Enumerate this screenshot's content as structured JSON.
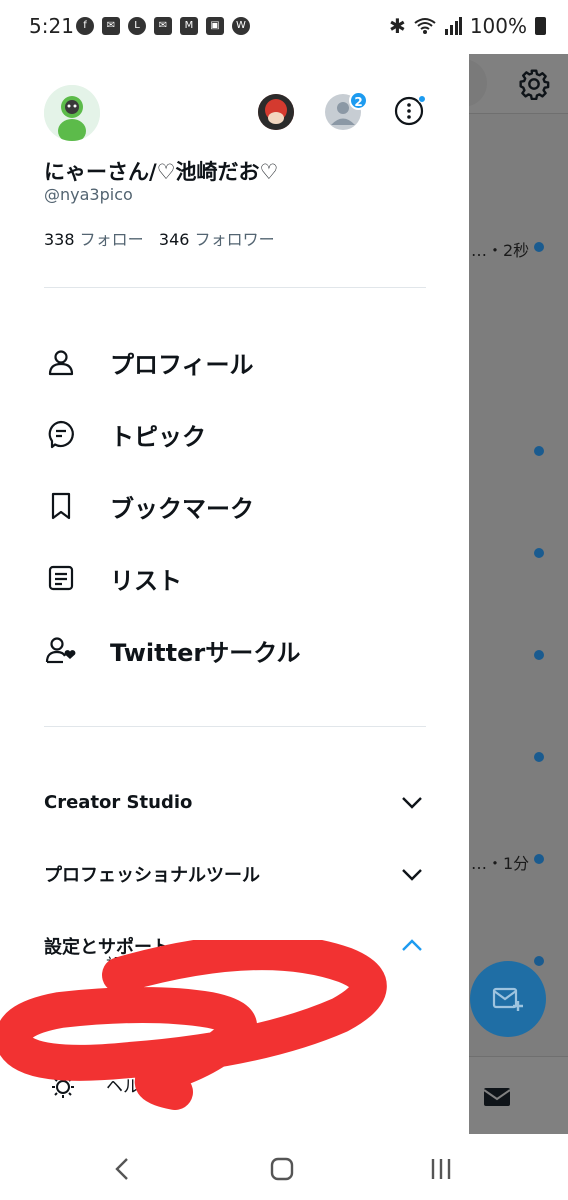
{
  "status_bar": {
    "time": "5:21",
    "battery": "100%",
    "left_icons": [
      "facebook-icon",
      "mail-icon",
      "line-icon",
      "mail-icon",
      "gmail-icon",
      "image-icon",
      "wear-icon"
    ],
    "right_icons": [
      "bluetooth-icon",
      "wifi-icon",
      "signal-icon",
      "battery-icon"
    ]
  },
  "profile": {
    "display_name": "にゃーさん/♡池崎だお♡",
    "handle": "@nya3pico",
    "following_count": "338",
    "following_label": "フォロー",
    "followers_count": "346",
    "followers_label": "フォロワー",
    "account_badge": "2"
  },
  "menu": [
    {
      "label": "プロフィール",
      "icon": "person-icon"
    },
    {
      "label": "トピック",
      "icon": "topic-icon"
    },
    {
      "label": "ブックマーク",
      "icon": "bookmark-icon"
    },
    {
      "label": "リスト",
      "icon": "list-icon"
    },
    {
      "label": "Twitterサークル",
      "icon": "circle-people-icon"
    }
  ],
  "sections": [
    {
      "label": "Creator Studio",
      "expanded": false
    },
    {
      "label": "プロフェッショナルツール",
      "expanded": false
    },
    {
      "label": "設定とサポート",
      "expanded": true
    }
  ],
  "settings_sub": {
    "item1": "設定とプライバシー",
    "item2": "ヘルプ"
  },
  "background_app": {
    "time_1": "…・2秒",
    "time_2": "…・1分"
  },
  "colors": {
    "accent": "#1d9bf0",
    "scribble": "#f23232",
    "overlay": "#7d7d7d"
  }
}
